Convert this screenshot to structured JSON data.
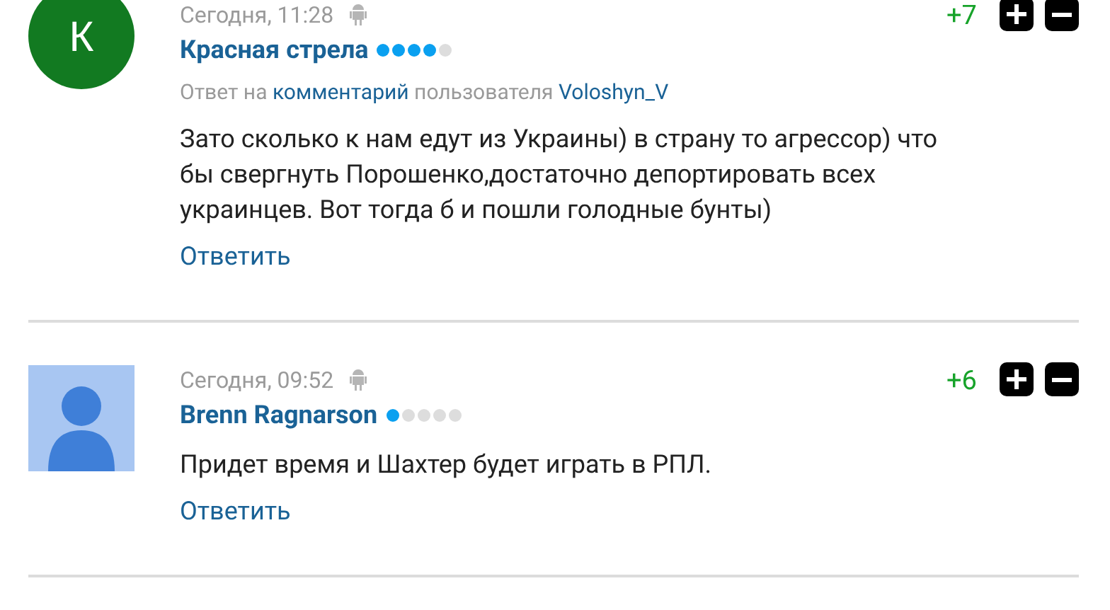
{
  "comments": [
    {
      "avatar": {
        "kind": "letter",
        "letter": "К",
        "color": "#127a21"
      },
      "time": "Сегодня, 11:28",
      "score": "+7",
      "author": "Красная стрела",
      "stars": 4,
      "reply_to": {
        "prefix": "Ответ на",
        "link": "комментарий",
        "middle": "пользователя",
        "user": "Voloshyn_V"
      },
      "text": "Зато сколько к нам едут из Украины) в страну то агрессор) что бы свергнуть Порошенко,достаточно депортировать всех украинцев. Вот тогда б и пошли голодные бунты)",
      "reply_button": "Ответить"
    },
    {
      "avatar": {
        "kind": "silhouette"
      },
      "time": "Сегодня, 09:52",
      "score": "+6",
      "author": "Brenn Ragnarson",
      "stars": 1,
      "text": "Придет время и Шахтер будет играть в РПЛ.",
      "reply_button": "Ответить"
    }
  ]
}
